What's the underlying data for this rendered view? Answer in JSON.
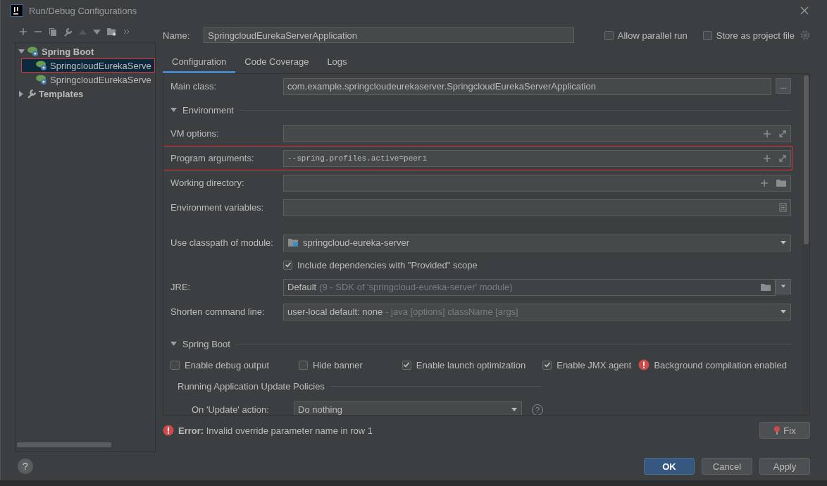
{
  "window": {
    "title": "Run/Debug Configurations"
  },
  "tree": [
    {
      "label": "Spring Boot",
      "kind": "group",
      "expanded": true,
      "children": [
        {
          "label": "SpringcloudEurekaServe",
          "selected": true,
          "highlighted": true
        },
        {
          "label": "SpringcloudEurekaServe",
          "selected": false,
          "highlighted": false
        }
      ]
    },
    {
      "label": "Templates",
      "kind": "templates",
      "expanded": false
    }
  ],
  "name_field": {
    "label": "Name:",
    "value": "SpringcloudEurekaServerApplication"
  },
  "options": [
    {
      "label": "Allow parallel run",
      "checked": false
    },
    {
      "label": "Store as project file",
      "checked": false
    }
  ],
  "tabs": [
    {
      "label": "Configuration",
      "selected": true
    },
    {
      "label": "Code Coverage",
      "selected": false
    },
    {
      "label": "Logs",
      "selected": false
    }
  ],
  "main_class": {
    "label": "Main class:",
    "value": "com.example.springcloudeurekaserver.SpringcloudEurekaServerApplication",
    "button": "..."
  },
  "environment": {
    "title": "Environment",
    "expanded": true,
    "fields": [
      {
        "label": "VM options:",
        "kind": "expandable",
        "highlighted": false
      },
      {
        "label": "Program arguments:",
        "kind": "expandable",
        "value": "--spring.profiles.active=peer1",
        "highlighted": true
      },
      {
        "label": "Working directory:",
        "kind": "folder",
        "highlighted": false
      },
      {
        "label": "Environment variables:",
        "kind": "document",
        "highlighted": false
      }
    ]
  },
  "module": {
    "label": "Use classpath of module:",
    "value": "springcloud-eureka-server"
  },
  "include_provided": {
    "label": "Include dependencies with \"Provided\" scope",
    "checked": true
  },
  "jre": {
    "label": "JRE:",
    "value": "Default",
    "hint": "(9 - SDK of 'springcloud-eureka-server' module)"
  },
  "shorten": {
    "label": "Shorten command line:",
    "value": "user-local default: none",
    "hint": "- java [options] className [args]"
  },
  "spring_boot": {
    "title": "Spring Boot",
    "expanded": true,
    "checkboxes": [
      {
        "label": "Enable debug output",
        "checked": false
      },
      {
        "label": "Hide banner",
        "checked": false
      },
      {
        "label": "Enable launch optimization",
        "checked": true
      },
      {
        "label": "Enable JMX agent",
        "checked": true
      }
    ],
    "warning": "Background compilation enabled",
    "policies": {
      "title": "Running Application Update Policies",
      "label": "On 'Update' action:",
      "value": "Do nothing",
      "help": "?"
    }
  },
  "error": "**Error:** Invalid override parameter name in row 1",
  "fix_button": "Fix",
  "help_button": "?",
  "buttons": [
    {
      "label": "OK",
      "kind": "primary"
    },
    {
      "label": "Cancel",
      "kind": "normal"
    },
    {
      "label": "Apply",
      "kind": "normal"
    }
  ]
}
